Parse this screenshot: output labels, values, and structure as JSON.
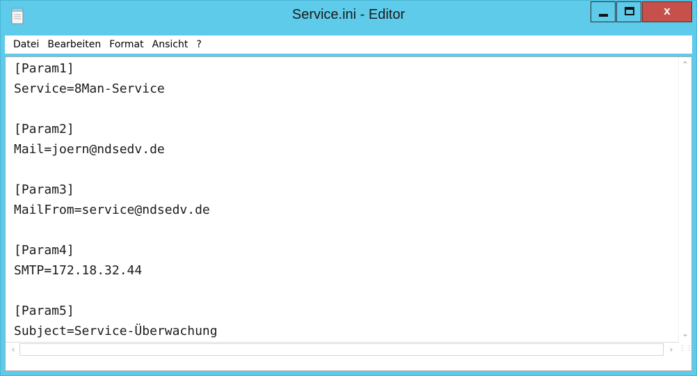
{
  "window": {
    "title": "Service.ini - Editor",
    "close_glyph": "x",
    "icons": {
      "app": "notepad-icon",
      "minimize": "minimize-icon",
      "maximize": "maximize-icon",
      "close": "close-icon"
    }
  },
  "menu": {
    "items": [
      "Datei",
      "Bearbeiten",
      "Format",
      "Ansicht",
      "?"
    ]
  },
  "editor": {
    "lines": [
      "[Param1]",
      "Service=8Man-Service",
      "",
      "[Param2]",
      "Mail=joern@ndsedv.de",
      "",
      "[Param3]",
      "MailFrom=service@ndsedv.de",
      "",
      "[Param4]",
      "SMTP=172.18.32.44",
      "",
      "[Param5]",
      "Subject=Service-Überwachung"
    ]
  },
  "colors": {
    "titlebar": "#5ecbea",
    "close_button": "#c7504a"
  }
}
